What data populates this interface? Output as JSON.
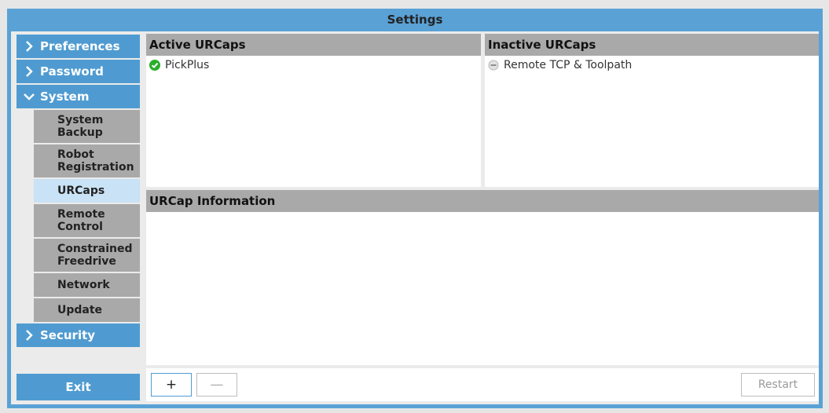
{
  "window": {
    "title": "Settings"
  },
  "sidebar": {
    "items": [
      {
        "label": "Preferences",
        "icon": "chevron-right-icon"
      },
      {
        "label": "Password",
        "icon": "chevron-right-icon"
      },
      {
        "label": "System",
        "icon": "chevron-down-icon"
      },
      {
        "label": "Security",
        "icon": "chevron-right-icon"
      }
    ],
    "subitems": [
      {
        "label": "System\nBackup"
      },
      {
        "label": "Robot\nRegistration"
      },
      {
        "label": "URCaps",
        "active": true
      },
      {
        "label": "Remote\nControl"
      },
      {
        "label": "Constrained\nFreedrive"
      },
      {
        "label": "Network"
      },
      {
        "label": "Update"
      }
    ],
    "exit_label": "Exit"
  },
  "active_urcaps": {
    "header": "Active URCaps",
    "items": [
      {
        "label": "PickPlus",
        "icon": "check-circle-icon",
        "status_color": "#2bae2b"
      }
    ]
  },
  "inactive_urcaps": {
    "header": "Inactive URCaps",
    "items": [
      {
        "label": "Remote TCP & Toolpath",
        "icon": "minus-circle-icon",
        "status_color": "#b8b8b8"
      }
    ]
  },
  "urcap_info": {
    "header": "URCap Information"
  },
  "toolbar": {
    "add_label": "+",
    "remove_label": "—",
    "restart_label": "Restart"
  },
  "colors": {
    "accent": "#4f9bd1",
    "titlebar": "#5aa1d5",
    "panel_header": "#a9a9a9",
    "active_subitem": "#c9e2f5"
  }
}
